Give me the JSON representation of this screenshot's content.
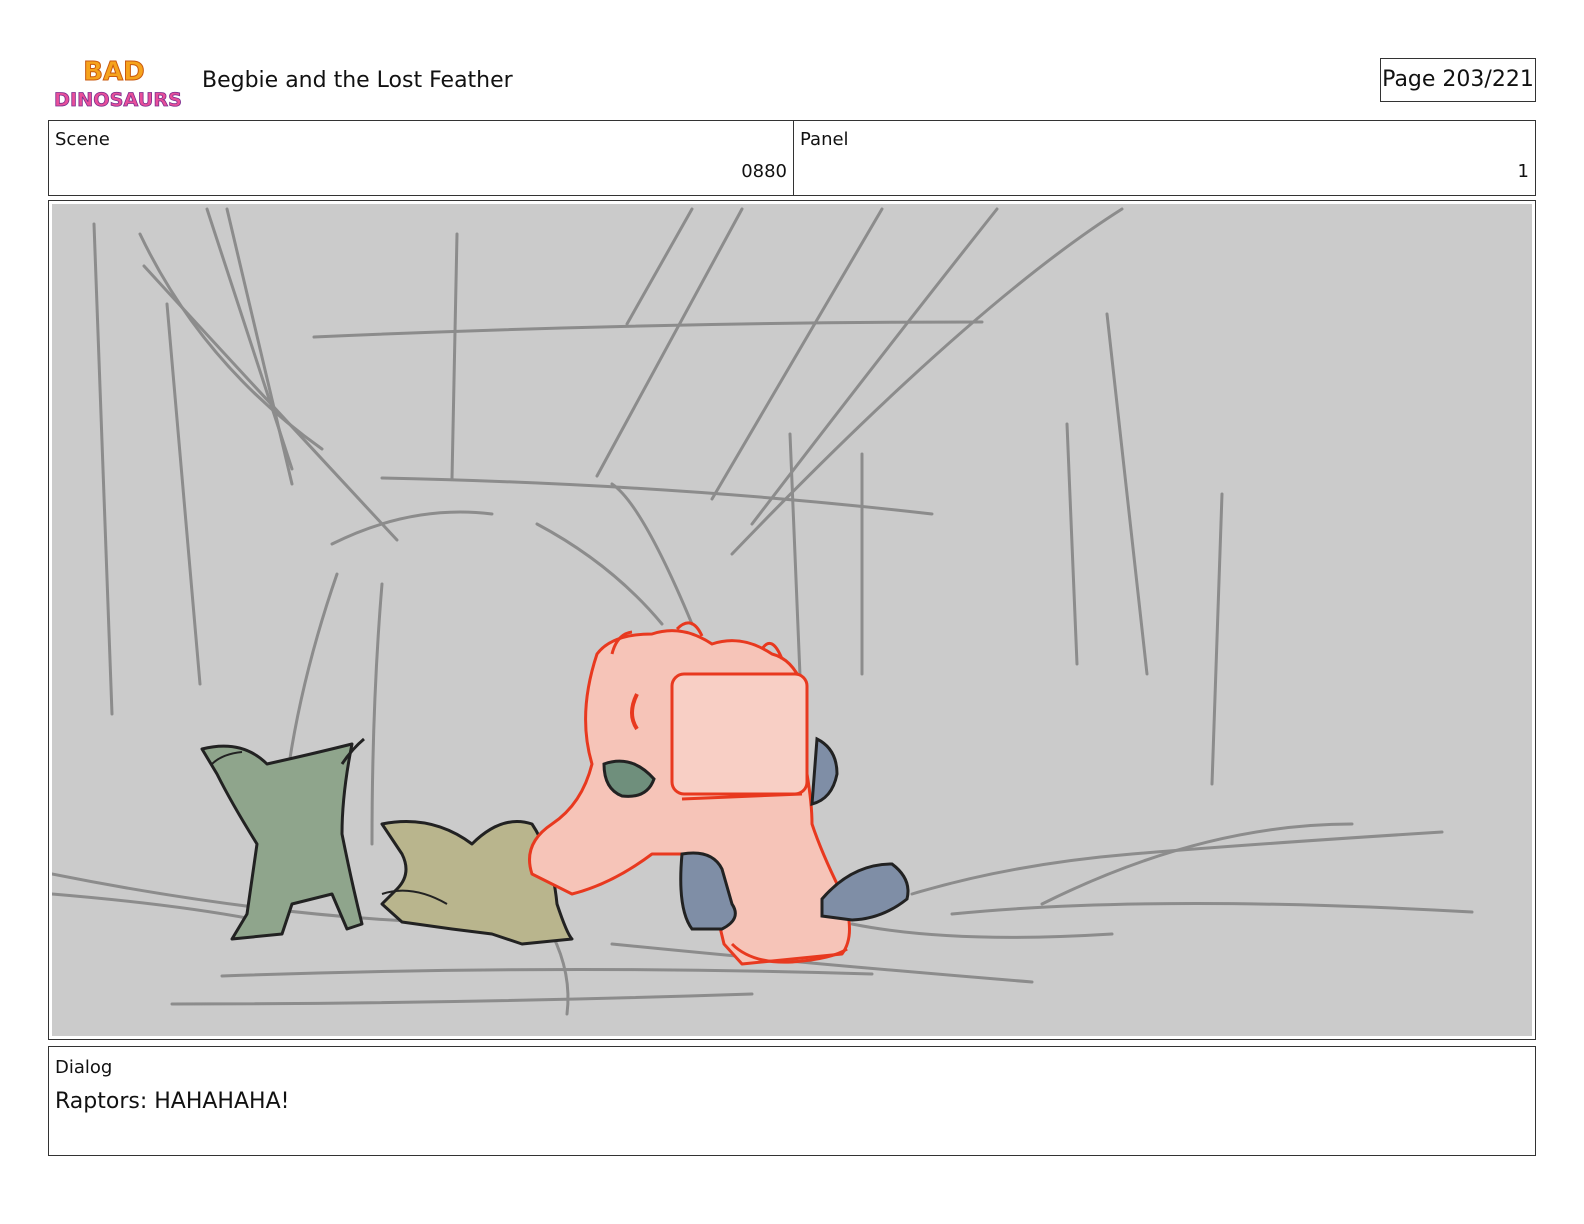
{
  "header": {
    "logo_text_top": "BAD",
    "logo_text_bottom": "DINOSAURS",
    "title": "Begbie and the Lost Feather",
    "page": "Page 203/221"
  },
  "meta": {
    "scene_label": "Scene",
    "scene_value": "0880",
    "panel_label": "Panel",
    "panel_value": "1"
  },
  "dialog": {
    "label": "Dialog",
    "text": "Raptors: HAHAHAHA!"
  },
  "colors": {
    "background": "#cbcbcb",
    "sketch_lines": "#8c8c8c",
    "begbie_fill": "#f6c4b8",
    "begbie_line": "#e8391f",
    "raptor_green": "#8fa58c",
    "raptor_olive": "#b9b58d",
    "raptor_blue": "#7f8ea6"
  }
}
